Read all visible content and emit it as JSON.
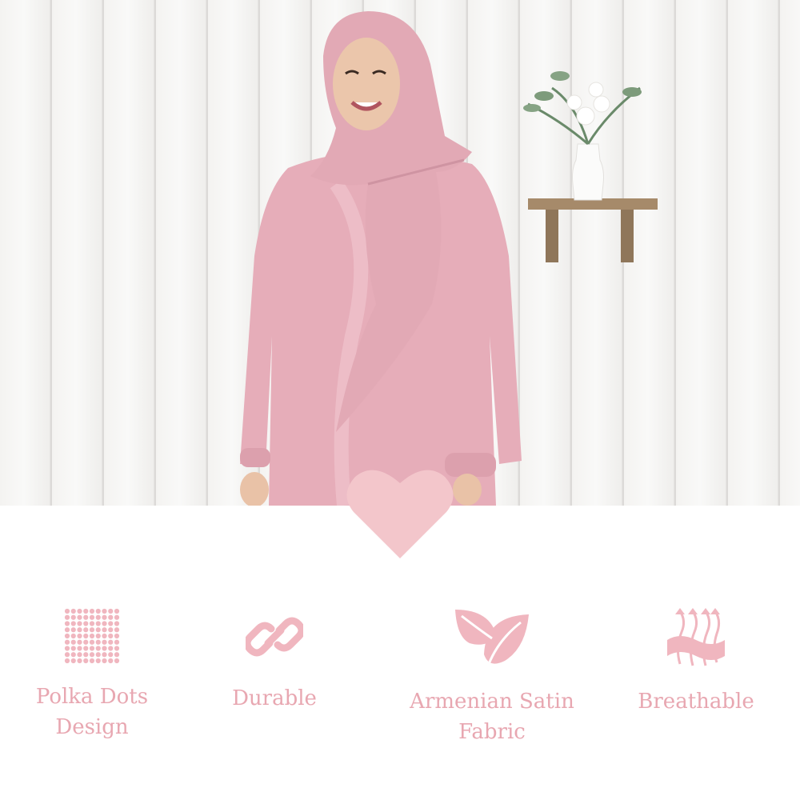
{
  "hero": {
    "image_alt": "Model wearing pink polka dot satin abaya with matching hijab",
    "accent_color": "#f3c6cb",
    "dress_color": "#e6adb9"
  },
  "features": [
    {
      "icon": "polka-dots-icon",
      "label_line1": "Polka Dots",
      "label_line2": "Design"
    },
    {
      "icon": "chain-link-icon",
      "label_line1": "Durable",
      "label_line2": ""
    },
    {
      "icon": "leaf-icon",
      "label_line1": "Armenian Satin",
      "label_line2": "Fabric"
    },
    {
      "icon": "breathable-fabric-icon",
      "label_line1": "Breathable",
      "label_line2": ""
    }
  ],
  "colors": {
    "label": "#e8a7b1",
    "icon": "#f0b6bf"
  }
}
